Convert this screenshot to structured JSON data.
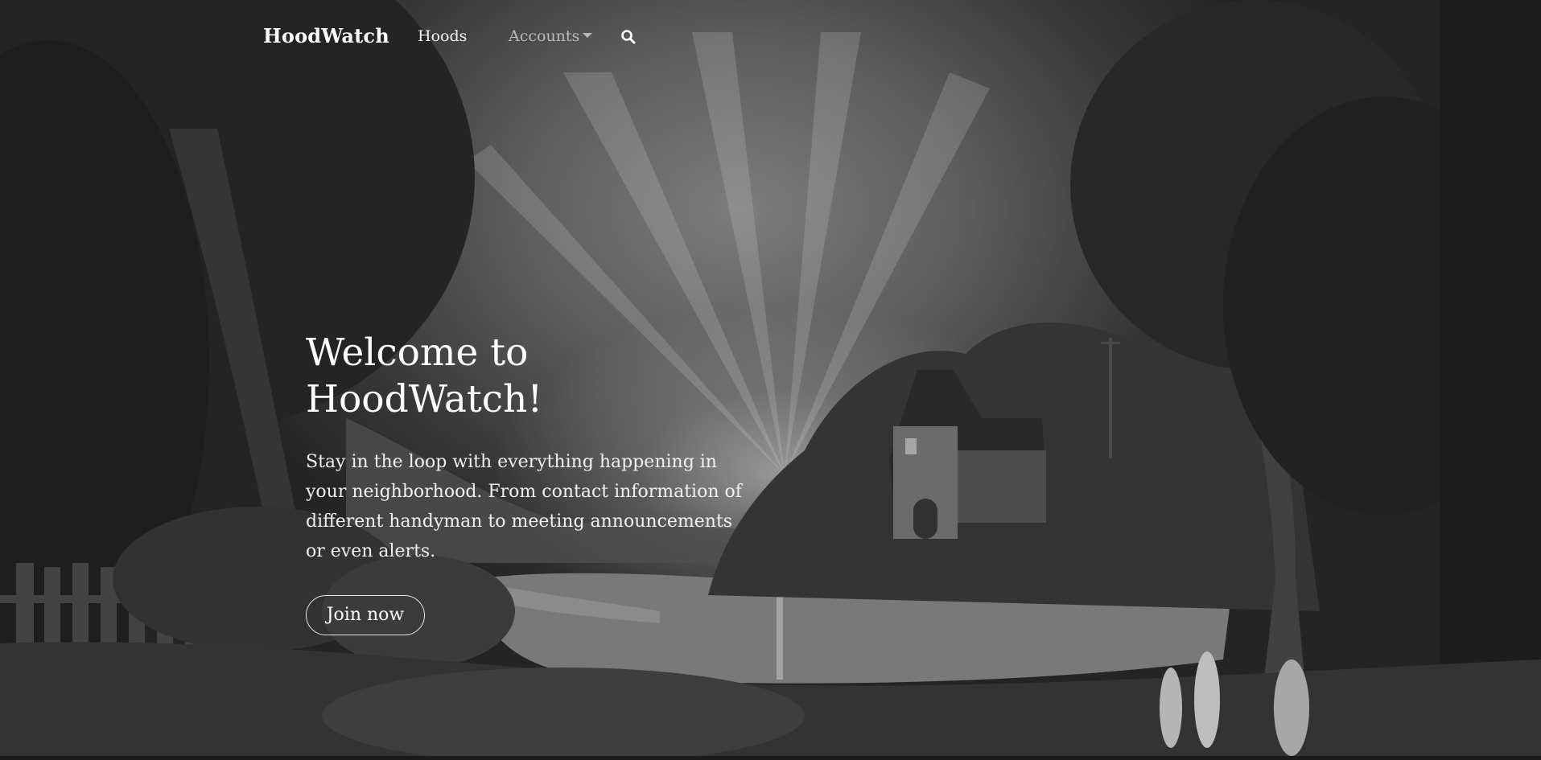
{
  "navbar": {
    "brand": "HoodWatch",
    "links": [
      {
        "label": "Hoods"
      },
      {
        "label": "Accounts",
        "dropdown": true
      }
    ],
    "search_icon": "search-icon"
  },
  "hero": {
    "headline": "Welcome to HoodWatch!",
    "lead": "Stay in the loop with everything happening in your neighborhood. From contact information of different handyman to meeting announcements or even alerts.",
    "cta_label": "Join now"
  },
  "colors": {
    "text": "#ffffff",
    "muted_link": "#b9b9b9",
    "background": "#2b2b2b"
  }
}
